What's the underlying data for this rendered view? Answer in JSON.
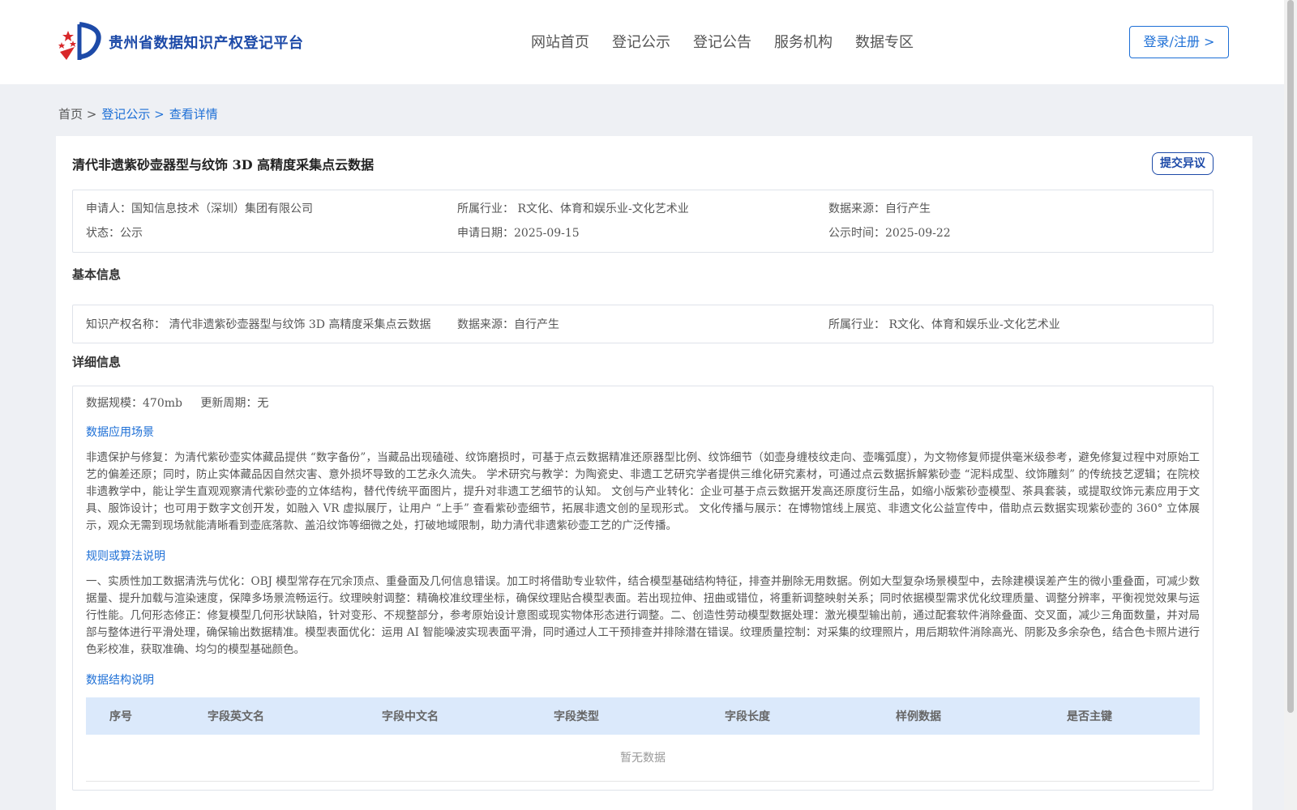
{
  "header": {
    "site_title": "贵州省数据知识产权登记平台",
    "nav": [
      "网站首页",
      "登记公示",
      "登记公告",
      "服务机构",
      "数据专区"
    ],
    "login_label": "登录/注册 >"
  },
  "breadcrumb": [
    "首页 >",
    "登记公示 >",
    "查看详情"
  ],
  "record": {
    "title": "清代非遗紫砂壶器型与纹饰 3D 高精度采集点云数据",
    "objection_label": "提交异议",
    "applicant": "申请人：国知信息技术（深圳）集团有限公司",
    "industry": "所属行业： R文化、体育和娱乐业-文化艺术业",
    "source": "数据来源：自行产生",
    "status": "状态：公示",
    "apply_date": "申请日期：2025-09-15",
    "publish_date": "公示时间：2025-09-22"
  },
  "basic": {
    "section_title": "基本信息",
    "ip_name": "知识产权名称： 清代非遗紫砂壶器型与纹饰 3D 高精度采集点云数据",
    "source": "数据来源：自行产生",
    "industry": "所属行业： R文化、体育和娱乐业-文化艺术业"
  },
  "detail": {
    "section_title": "详细信息",
    "scale": "数据规模：470mb",
    "update_cycle": "更新周期：无",
    "scenario_title": "数据应用场景",
    "scenario_text": "非遗保护与修复：为清代紫砂壶实体藏品提供 “数字备份”，当藏品出现磕碰、纹饰磨损时，可基于点云数据精准还原器型比例、纹饰细节（如壶身缠枝纹走向、壶嘴弧度），为文物修复师提供毫米级参考，避免修复过程中对原始工艺的偏差还原；同时，防止实体藏品因自然灾害、意外损坏导致的工艺永久流失。 学术研究与教学：为陶瓷史、非遗工艺研究学者提供三维化研究素材，可通过点云数据拆解紫砂壶 “泥料成型、纹饰雕刻” 的传统技艺逻辑；在院校非遗教学中，能让学生直观观察清代紫砂壶的立体结构，替代传统平面图片，提升对非遗工艺细节的认知。 文创与产业转化：企业可基于点云数据开发高还原度衍生品，如缩小版紫砂壶模型、茶具套装，或提取纹饰元素应用于文具、服饰设计；也可用于数字文创开发，如融入 VR 虚拟展厅，让用户 “上手” 查看紫砂壶细节，拓展非遗文创的呈现形式。 文化传播与展示：在博物馆线上展览、非遗文化公益宣传中，借助点云数据实现紫砂壶的 360° 立体展示，观众无需到现场就能清晰看到壶底落款、盖沿纹饰等细微之处，打破地域限制，助力清代非遗紫砂壶工艺的广泛传播。",
    "rules_title": "规则或算法说明",
    "rules_text": "一、实质性加工数据清洗与优化：OBJ 模型常存在冗余顶点、重叠面及几何信息错误。加工时将借助专业软件，结合模型基础结构特征，排查并删除无用数据。例如大型复杂场景模型中，去除建模误差产生的微小重叠面，可减少数据量、提升加载与渲染速度，保障多场景流畅运行。纹理映射调整：精确校准纹理坐标，确保纹理贴合模型表面。若出现拉伸、扭曲或错位，将重新调整映射关系；同时依据模型需求优化纹理质量、调整分辨率，平衡视觉效果与运行性能。几何形态修正：修复模型几何形状缺陷，针对变形、不规整部分，参考原始设计意图或现实物体形态进行调整。二、创造性劳动模型数据处理：激光模型输出前，通过配套软件消除叠面、交叉面，减少三角面数量，并对局部与整体进行平滑处理，确保输出数据精准。模型表面优化：运用 AI 智能噪波实现表面平滑，同时通过人工干预排查并排除潜在错误。纹理质量控制：对采集的纹理照片，用后期软件消除高光、阴影及多余杂色，结合色卡照片进行色彩校准，获取准确、均匀的模型基础颜色。",
    "structure_title": "数据结构说明",
    "table_headers": [
      "序号",
      "字段英文名",
      "字段中文名",
      "字段类型",
      "字段长度",
      "样例数据",
      "是否主键"
    ],
    "empty_text": "暂无数据"
  }
}
